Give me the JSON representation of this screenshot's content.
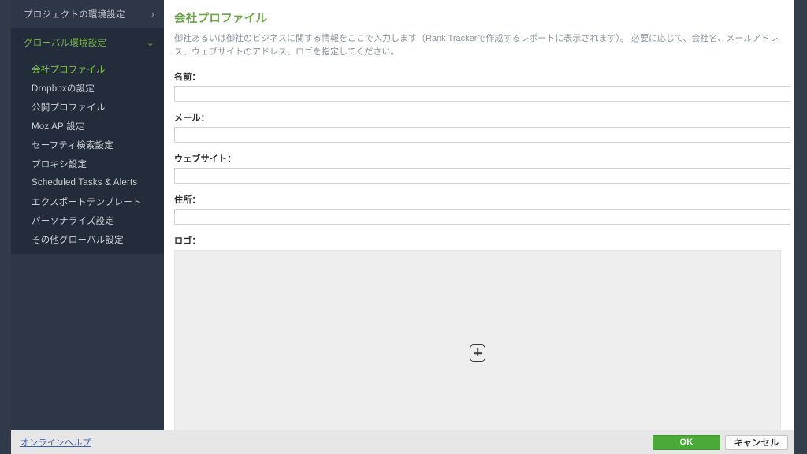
{
  "sidebar": {
    "top_items": [
      {
        "label": "プロジェクトの環境設定",
        "icon": "chevron-right-icon",
        "chevron": "›",
        "active": false
      },
      {
        "label": "グローバル環境設定",
        "icon": "chevron-down-icon",
        "chevron": "⌄",
        "active": true
      }
    ],
    "submenu": [
      {
        "label": "会社プロファイル",
        "selected": true
      },
      {
        "label": "Dropboxの設定",
        "selected": false
      },
      {
        "label": "公開プロファイル",
        "selected": false
      },
      {
        "label": "Moz API設定",
        "selected": false
      },
      {
        "label": "セーフティ検索設定",
        "selected": false
      },
      {
        "label": "プロキシ設定",
        "selected": false
      },
      {
        "label": "Scheduled Tasks & Alerts",
        "selected": false
      },
      {
        "label": "エクスポートテンプレート",
        "selected": false
      },
      {
        "label": "パーソナライズ設定",
        "selected": false
      },
      {
        "label": "その他グローバル設定",
        "selected": false
      }
    ]
  },
  "main": {
    "title": "会社プロファイル",
    "description": "御社あるいは御社のビジネスに関する情報をここで入力します（Rank Trackerで作成するレポートに表示されます）。 必要に応じて、会社名、メールアドレス、ウェブサイトのアドレス、ロゴを指定してください。",
    "fields": [
      {
        "label": "名前：",
        "value": "",
        "placeholder": ""
      },
      {
        "label": "メール：",
        "value": "",
        "placeholder": ""
      },
      {
        "label": "ウェブサイト：",
        "value": "",
        "placeholder": ""
      },
      {
        "label": "住所：",
        "value": "",
        "placeholder": ""
      }
    ],
    "logo": {
      "label": "ロゴ：",
      "icon": "plus-in-rounded-square-icon"
    }
  },
  "footer": {
    "help_link": "オンラインヘルプ",
    "ok_label": "OK",
    "cancel_label": "キャンセル"
  },
  "colors": {
    "accent_green": "#7cc242",
    "button_green": "#4aaa38",
    "sidebar_bg": "#2e3747",
    "submenu_bg": "#232c3a",
    "link_blue": "#3d63b0"
  }
}
